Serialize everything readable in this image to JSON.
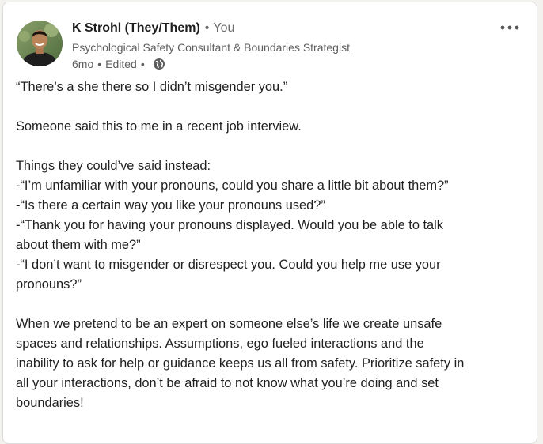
{
  "post": {
    "author": {
      "name": "K Strohl (They/Them)",
      "separator": "•",
      "relation": "You",
      "headline": "Psychological Safety Consultant & Boundaries Strategist",
      "time": "6mo",
      "edited": "Edited",
      "visibility_icon": "globe-icon"
    },
    "menu_icon": "ellipsis-icon",
    "paragraphs": {
      "p1": [
        "“There’s a she there so I didn’t misgender you.”"
      ],
      "p2": [
        "Someone said this to me in a recent job interview."
      ],
      "p3": [
        "Things they could’ve said instead:",
        "-“I’m unfamiliar with your pronouns, could you share a little bit about them?”",
        "-“Is there a certain way you like your pronouns used?”",
        "-“Thank you for having your pronouns displayed. Would you be able to talk",
        "about them with me?”",
        "-“I don’t want to misgender or disrespect you. Could you help me use your",
        "pronouns?”"
      ],
      "p4": [
        "When we pretend to be an expert on someone else’s life we create unsafe",
        "spaces and relationships. Assumptions, ego fueled interactions and the",
        "inability to ask for help or guidance keeps us all from safety. Prioritize safety in",
        "all your interactions, don’t be afraid to not know what you’re doing and set",
        "boundaries!"
      ]
    }
  }
}
